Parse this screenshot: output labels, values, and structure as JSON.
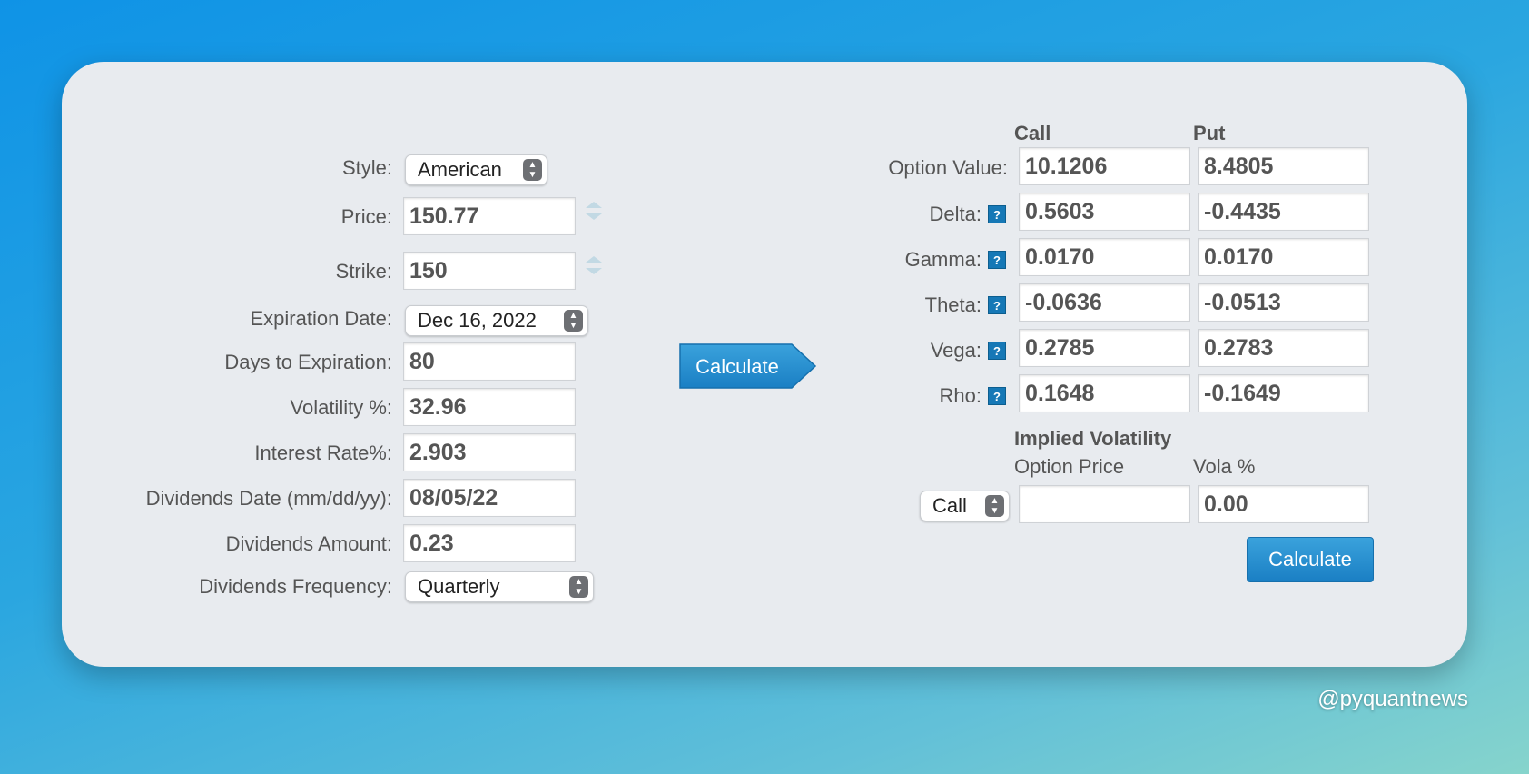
{
  "inputs": {
    "style": {
      "label": "Style:",
      "value": "American"
    },
    "price": {
      "label": "Price:",
      "value": "150.77"
    },
    "strike": {
      "label": "Strike:",
      "value": "150"
    },
    "expiration": {
      "label": "Expiration Date:",
      "value": "Dec 16, 2022"
    },
    "days": {
      "label": "Days to Expiration:",
      "value": "80"
    },
    "volatility": {
      "label": "Volatility %:",
      "value": "32.96"
    },
    "interest": {
      "label": "Interest Rate%:",
      "value": "2.903"
    },
    "div_date": {
      "label": "Dividends Date (mm/dd/yy):",
      "value": "08/05/22"
    },
    "div_amount": {
      "label": "Dividends Amount:",
      "value": "0.23"
    },
    "div_freq": {
      "label": "Dividends Frequency:",
      "value": "Quarterly"
    }
  },
  "calculate_label": "Calculate",
  "results": {
    "call_header": "Call",
    "put_header": "Put",
    "rows": [
      {
        "label": "Option Value:",
        "call": "10.1206",
        "put": "8.4805"
      },
      {
        "label": "Delta:",
        "call": "0.5603",
        "put": "-0.4435"
      },
      {
        "label": "Gamma:",
        "call": "0.0170",
        "put": "0.0170"
      },
      {
        "label": "Theta:",
        "call": "-0.0636",
        "put": "-0.0513"
      },
      {
        "label": "Vega:",
        "call": "0.2785",
        "put": "0.2783"
      },
      {
        "label": "Rho:",
        "call": "0.1648",
        "put": "-0.1649"
      }
    ],
    "help_glyph": "?"
  },
  "implied": {
    "title": "Implied Volatility",
    "option_price_label": "Option Price",
    "vola_label": "Vola %",
    "type_value": "Call",
    "option_price_value": "",
    "vola_value": "0.00",
    "calculate_label": "Calculate"
  },
  "watermark": "@pyquantnews",
  "icons": {
    "select_arrows": "up-down-chevron-icon",
    "help": "question-mark-icon",
    "spinner": "number-spinner-icon"
  },
  "colors": {
    "button_blue": "#1a7fc4",
    "help_blue": "#1678b6"
  }
}
